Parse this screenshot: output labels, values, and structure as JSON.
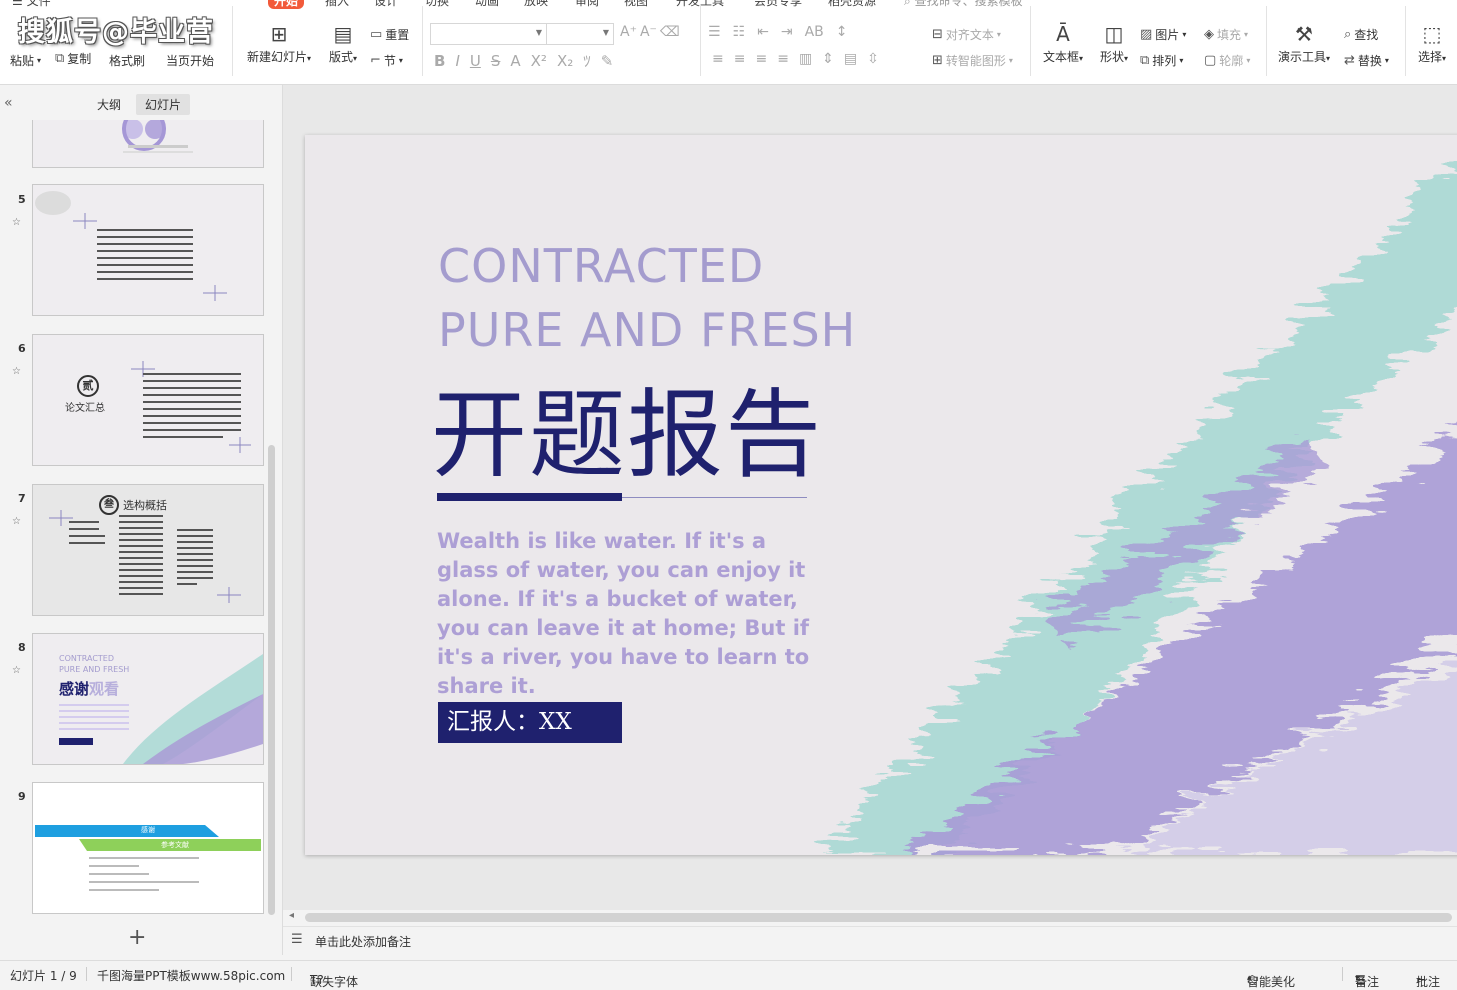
{
  "watermark": "搜狐号@毕业营",
  "menu_tabs": [
    "文件",
    "开始",
    "插入",
    "设计",
    "切换",
    "动画",
    "放映",
    "审阅",
    "视图",
    "开发工具",
    "会员专享",
    "稻壳资源"
  ],
  "search_placeholder": "查找命令、搜索模板",
  "ribbon": {
    "paste": "粘贴",
    "cut": "剪切",
    "copy": "复制",
    "format_painter": "格式刷",
    "from_current": "当页开始",
    "new_slide": "新建幻灯片",
    "layout": "版式",
    "reset": "重置",
    "section": "节",
    "align_text": "对齐文本",
    "to_smartart": "转智能图形",
    "textbox": "文本框",
    "shape": "形状",
    "picture": "图片",
    "fill": "填充",
    "arrange": "排列",
    "outline": "轮廓",
    "presenter_tools": "演示工具",
    "find": "查找",
    "replace": "替换",
    "select": "选择"
  },
  "pane": {
    "tab_outline": "大纲",
    "tab_slides": "幻灯片",
    "slide_numbers": [
      "5",
      "6",
      "7",
      "8",
      "9"
    ],
    "thumb6_label": "论文汇总",
    "thumb6_badge": "贰",
    "thumb7_title": "选构概括",
    "thumb7_badge": "叁",
    "thumb8_en1": "CONTRACTED",
    "thumb8_en2": "PURE AND FRESH",
    "thumb8_cn_a": "感谢",
    "thumb8_cn_b": "观看",
    "thumb9_bar1": "感谢",
    "thumb9_bar2": "参考文献"
  },
  "slide": {
    "title_en_line1": "CONTRACTED",
    "title_en_line2": "PURE AND FRESH",
    "title_cn": "开题报告",
    "quote": "Wealth is like water. If it's a glass of water, you can enjoy it alone. If it's a bucket of water, you can leave it at home; But if it's a river, you have to learn to share it.",
    "reporter": "汇报人：XX"
  },
  "notes_placeholder": "单击此处添加备注",
  "status": {
    "slide_counter": "幻灯片 1 / 9",
    "template_name": "千图海量PPT模板www.58pic.com",
    "missing_font": "缺失字体",
    "smart_beautify": "智能美化",
    "notes": "备注",
    "comments": "批注"
  },
  "colors": {
    "accent_orange": "#f25a3a",
    "slide_navy": "#1f216e",
    "slide_lavender": "#a49cce",
    "brush_teal": "#a8d8d4",
    "brush_purple": "#a99bd6"
  }
}
